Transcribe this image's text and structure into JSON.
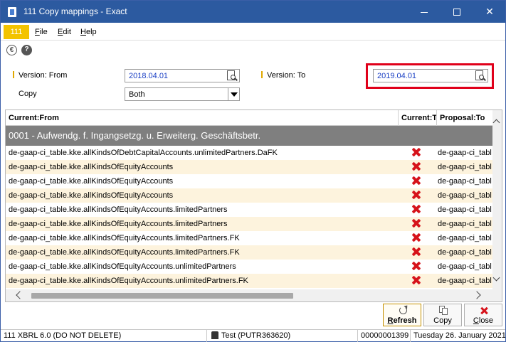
{
  "window": {
    "title": "111 Copy mappings - Exact"
  },
  "menubar": {
    "company": "111",
    "items": [
      {
        "label": "File",
        "key": "F",
        "rest": "ile"
      },
      {
        "label": "Edit",
        "key": "E",
        "rest": "dit"
      },
      {
        "label": "Help",
        "key": "H",
        "rest": "elp"
      }
    ]
  },
  "toolbar_icons": [
    "euro-icon",
    "help-icon"
  ],
  "form": {
    "version_from_label": "Version: From",
    "version_from_value": "2018.04.01",
    "version_to_label": "Version: To",
    "version_to_value": "2019.04.01",
    "copy_label": "Copy",
    "copy_value": "Both"
  },
  "grid": {
    "columns": [
      "Current:From",
      "Current:To",
      "Proposal:To"
    ],
    "group": "0001 - Aufwendg. f. Ingangsetzg. u. Erweiterg. Geschäftsbetr.",
    "rows": [
      {
        "from": "de-gaap-ci_table.kke.allKindsOfDebtCapitalAccounts.unlimitedPartners.DaFK",
        "to_status": "x-icon",
        "proposal": "de-gaap-ci_table"
      },
      {
        "from": "de-gaap-ci_table.kke.allKindsOfEquityAccounts",
        "to_status": "x-icon",
        "proposal": "de-gaap-ci_table"
      },
      {
        "from": "de-gaap-ci_table.kke.allKindsOfEquityAccounts",
        "to_status": "x-icon",
        "proposal": "de-gaap-ci_table"
      },
      {
        "from": "de-gaap-ci_table.kke.allKindsOfEquityAccounts",
        "to_status": "x-icon",
        "proposal": "de-gaap-ci_table"
      },
      {
        "from": "de-gaap-ci_table.kke.allKindsOfEquityAccounts.limitedPartners",
        "to_status": "x-icon",
        "proposal": "de-gaap-ci_table"
      },
      {
        "from": "de-gaap-ci_table.kke.allKindsOfEquityAccounts.limitedPartners",
        "to_status": "x-icon",
        "proposal": "de-gaap-ci_table"
      },
      {
        "from": "de-gaap-ci_table.kke.allKindsOfEquityAccounts.limitedPartners.FK",
        "to_status": "x-icon",
        "proposal": "de-gaap-ci_table"
      },
      {
        "from": "de-gaap-ci_table.kke.allKindsOfEquityAccounts.limitedPartners.FK",
        "to_status": "x-icon",
        "proposal": "de-gaap-ci_table"
      },
      {
        "from": "de-gaap-ci_table.kke.allKindsOfEquityAccounts.unlimitedPartners",
        "to_status": "x-icon",
        "proposal": "de-gaap-ci_table"
      },
      {
        "from": "de-gaap-ci_table.kke.allKindsOfEquityAccounts.unlimitedPartners.FK",
        "to_status": "x-icon",
        "proposal": "de-gaap-ci_table"
      }
    ]
  },
  "buttons": {
    "refresh": {
      "key": "R",
      "rest": "efresh"
    },
    "copy": {
      "key": "",
      "rest": "Copy"
    },
    "close": {
      "key": "C",
      "rest": "lose"
    }
  },
  "statusbar": {
    "company": "111 XBRL 6.0 (DO NOT DELETE)",
    "user": "Test (PUTR363620)",
    "number": "00000001399",
    "date": "Tuesday 26. January 2021"
  },
  "colors": {
    "titlebar": "#2c5aa0",
    "company_badge": "#f3c300",
    "highlight": "#e0001a",
    "group_row": "#7f7f7f",
    "alt_row": "#fdf3dd",
    "value_text": "#1a3fc4"
  }
}
